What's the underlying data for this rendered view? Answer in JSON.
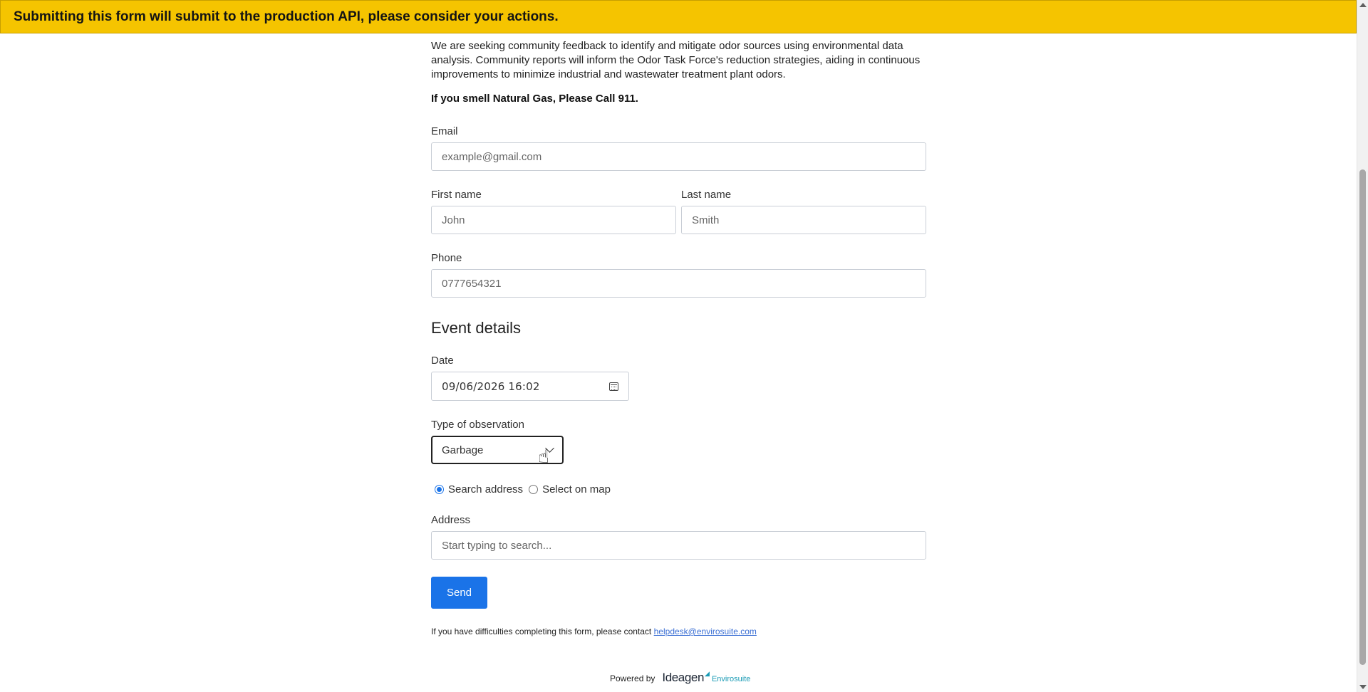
{
  "banner": {
    "text": "Submitting this form will submit to the production API, please consider your actions."
  },
  "intro": {
    "text": "We are seeking community feedback to identify and mitigate odor sources using environmental data analysis. Community reports will inform the Odor Task Force's reduction strategies, aiding in continuous improvements to minimize industrial and wastewater treatment plant odors.",
    "warning": "If you smell Natural Gas, Please Call 911."
  },
  "contact": {
    "email_label": "Email",
    "email_placeholder": "example@gmail.com",
    "first_name_label": "First name",
    "first_name_placeholder": "John",
    "last_name_label": "Last name",
    "last_name_placeholder": "Smith",
    "phone_label": "Phone",
    "phone_placeholder": "0777654321"
  },
  "event": {
    "title": "Event details",
    "date_label": "Date",
    "date_value": "09/06/2026 16:02",
    "type_label": "Type of observation",
    "type_value": "Garbage",
    "location_options": [
      {
        "label": "Search address",
        "checked": true
      },
      {
        "label": "Select on map",
        "checked": false
      }
    ],
    "address_label": "Address",
    "address_placeholder": "Start typing to search..."
  },
  "actions": {
    "send_label": "Send"
  },
  "footer": {
    "help_text": "If you have difficulties completing this form, please contact",
    "help_email": "helpdesk@envirosuite.com",
    "powered_by": "Powered by",
    "logo_main": "Ideagen",
    "logo_sub": "Envirosuite"
  },
  "colors": {
    "banner_bg": "#f5c400",
    "primary": "#1a73e8",
    "logo_accent": "#1a9bb5"
  },
  "icons": {
    "calendar": "calendar-icon",
    "dropdown": "chevron-down-icon",
    "cursor": "hand-pointer-cursor"
  }
}
